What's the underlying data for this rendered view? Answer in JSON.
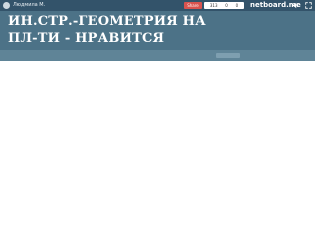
{
  "topbar": {
    "user_label": "Людмила М.",
    "share_label": "Share",
    "stats": [
      "313",
      "0",
      "0"
    ],
    "brand": "netboard.me"
  },
  "header": {
    "title": "ИН.СТР.-ГЕОМЕТРИЯ НА\nПЛ-ТИ - НРАВИТСЯ"
  },
  "subbar": {
    "button_label": ""
  },
  "icons": [
    "user-avatar",
    "sound-icon",
    "fullscreen-icon"
  ]
}
